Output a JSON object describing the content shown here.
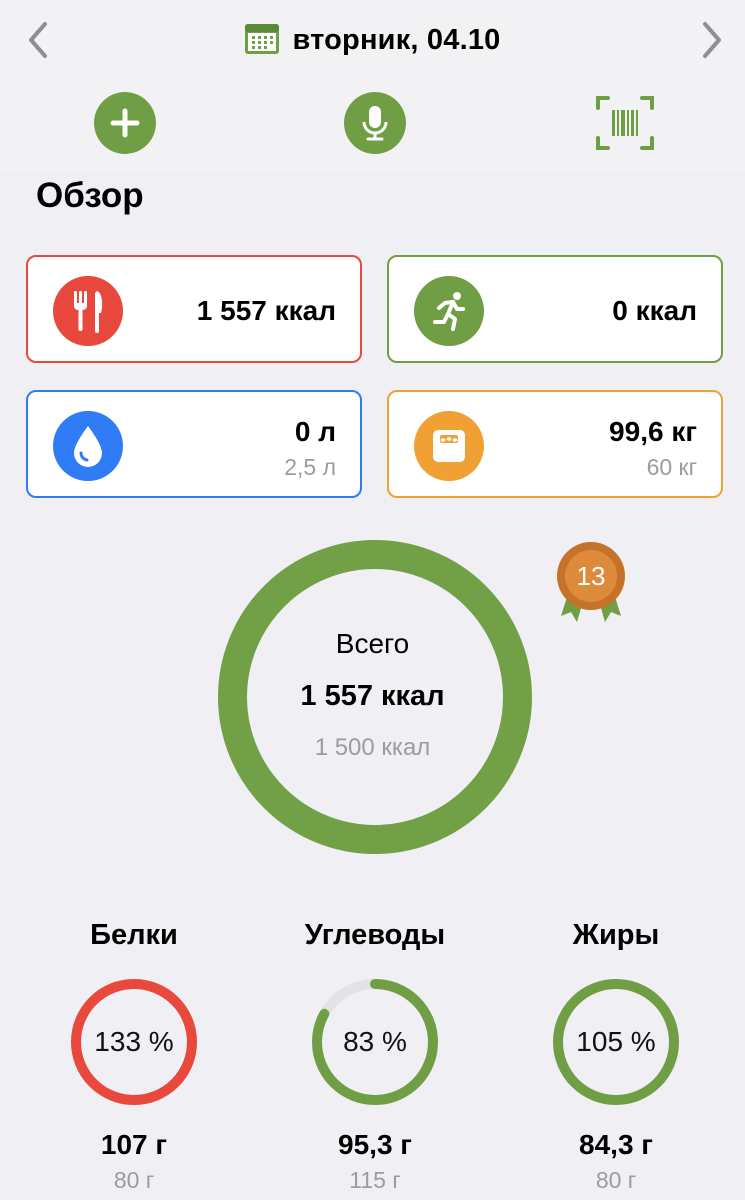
{
  "header": {
    "date": "вторник, 04.10",
    "prev_icon": "chevron-left-icon",
    "next_icon": "chevron-right-icon",
    "calendar_icon": "calendar-icon",
    "actions": [
      "add-icon",
      "microphone-icon",
      "barcode-scan-icon"
    ]
  },
  "overview": {
    "title": "Обзор",
    "food": {
      "value": "1 557 ккал",
      "icon": "fork-knife-icon",
      "color": "#e9483c"
    },
    "activity": {
      "value": "0 ккал",
      "icon": "running-icon",
      "color": "#6f9e45"
    },
    "water": {
      "value": "0 л",
      "goal": "2,5 л",
      "icon": "water-drop-icon",
      "color": "#2f7cf6"
    },
    "weight": {
      "value": "99,6 кг",
      "goal": "60 кг",
      "icon": "scale-icon",
      "color": "#f1a033"
    }
  },
  "total": {
    "label": "Всего",
    "value": "1 557 ккал",
    "goal": "1 500 ккал",
    "progress": 1.038,
    "color": "#72a047",
    "streak_badge": "13"
  },
  "macros": [
    {
      "name": "Белки",
      "percent": "133 %",
      "progress": 1.33,
      "value": "107 г",
      "goal": "80 г",
      "color": "#e9483c"
    },
    {
      "name": "Углеводы",
      "percent": "83 %",
      "progress": 0.83,
      "value": "95,3 г",
      "goal": "115 г",
      "color": "#6f9e45"
    },
    {
      "name": "Жиры",
      "percent": "105 %",
      "progress": 1.05,
      "value": "84,3 г",
      "goal": "80 г",
      "color": "#6f9e45"
    }
  ]
}
